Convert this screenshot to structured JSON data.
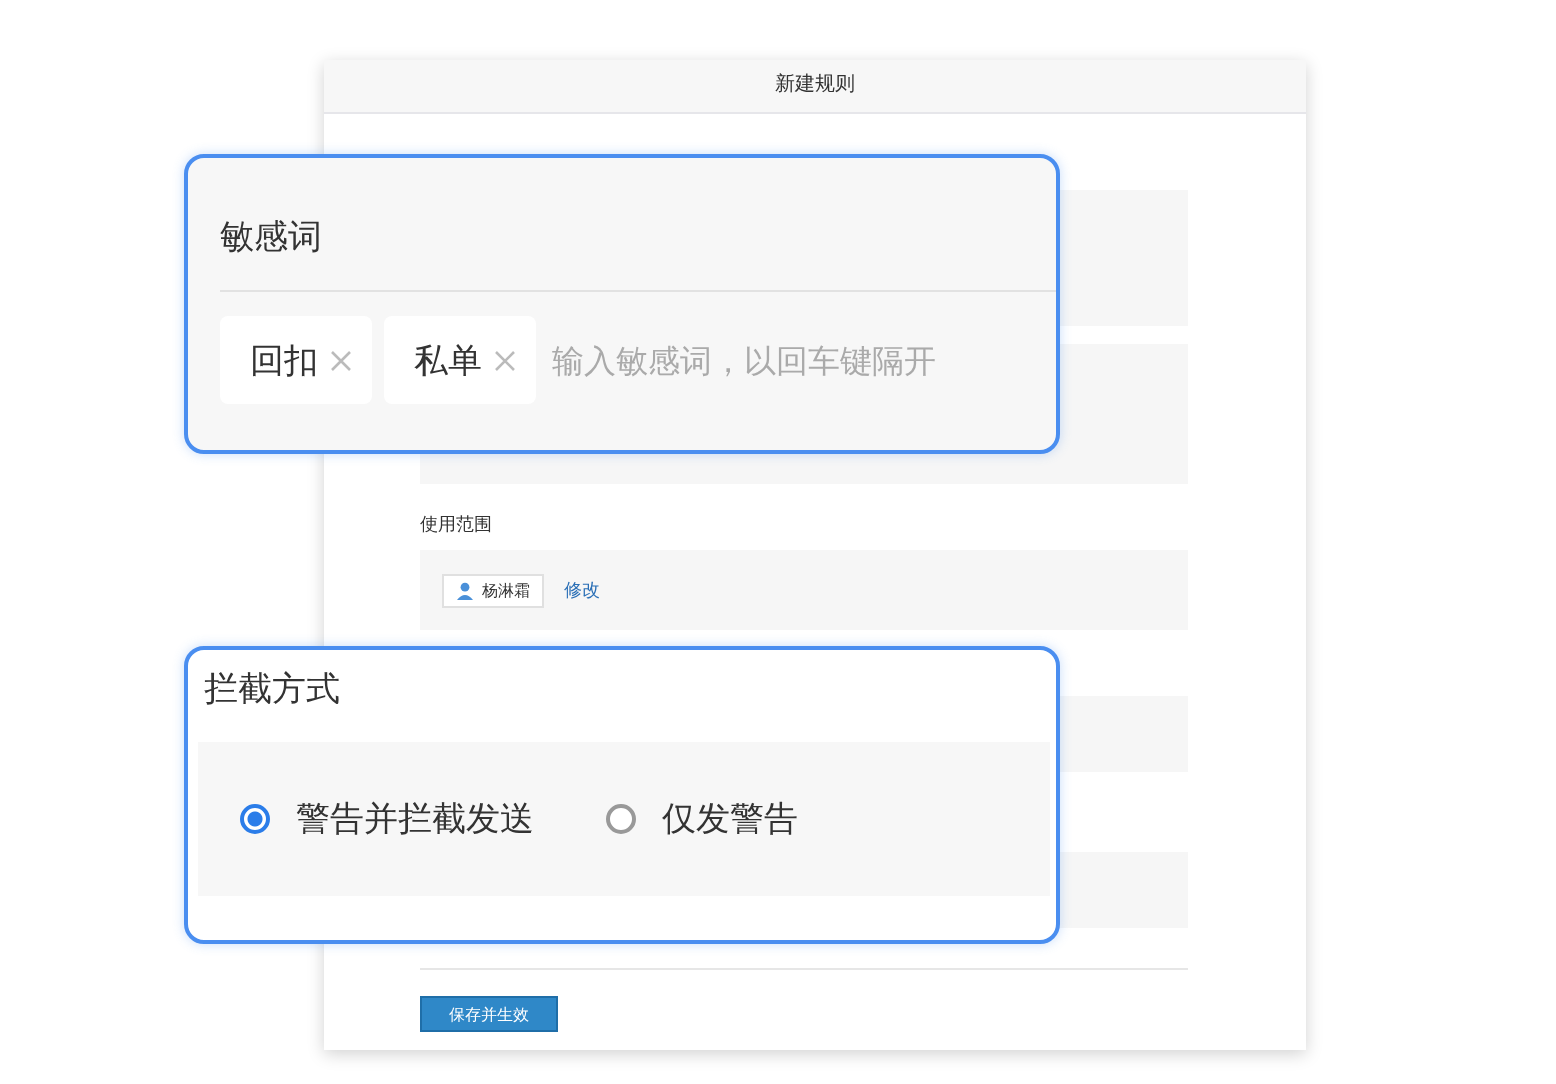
{
  "window": {
    "title": "新建规则"
  },
  "scope": {
    "label": "使用范围",
    "user": "杨淋霜",
    "edit_link": "修改"
  },
  "save_button": "保存并生效",
  "keyword_callout": {
    "title": "敏感词",
    "tags": [
      {
        "text": "回扣"
      },
      {
        "text": "私单"
      }
    ],
    "placeholder": "输入敏感词，以回车键隔开"
  },
  "intercept_callout": {
    "title": "拦截方式",
    "options": [
      {
        "label": "警告并拦截发送",
        "selected": true
      },
      {
        "label": "仅发警告",
        "selected": false
      }
    ]
  }
}
